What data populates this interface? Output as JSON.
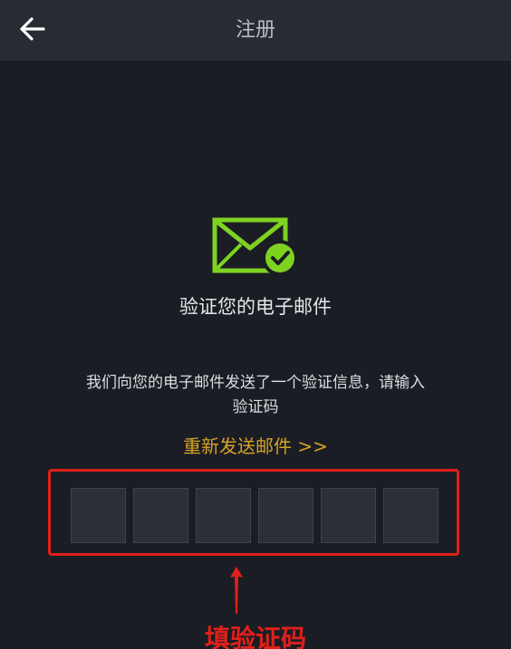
{
  "header": {
    "title": "注册",
    "back_icon": "arrow-left-icon"
  },
  "main": {
    "icon": "mail-check-icon",
    "heading": "验证您的电子邮件",
    "description_line1": "我们向您的电子邮件发送了一个验证信息，请输入",
    "description_line2": "验证码",
    "resend_label": "重新发送邮件 >>"
  },
  "code_input": {
    "length": 6,
    "digits": [
      "",
      "",
      "",
      "",
      "",
      ""
    ]
  },
  "annotation": {
    "label": "填验证码",
    "color": "#e0201b"
  },
  "colors": {
    "background": "#1b1d24",
    "header_background": "#272b33",
    "accent_green": "#7ed321",
    "resend_gold": "#d6a325",
    "highlight_red": "#e0201b"
  }
}
